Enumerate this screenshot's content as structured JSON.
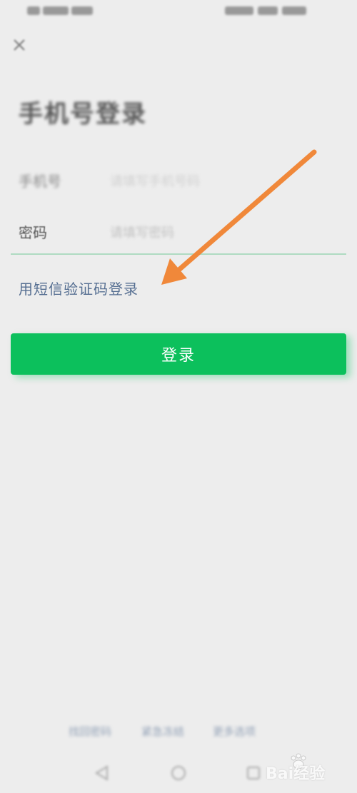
{
  "status_bar": {
    "left_text": "",
    "right_text": ""
  },
  "header": {
    "title": "手机号登录"
  },
  "form": {
    "phone": {
      "label": "手机号",
      "placeholder": "请填写手机号码"
    },
    "password": {
      "label": "密码",
      "placeholder": "请填写密码"
    }
  },
  "actions": {
    "sms_login_link": "用短信验证码登录",
    "login_button": "登录"
  },
  "footer": {
    "links": [
      "找回密码",
      "紧急冻结",
      "更多选项"
    ]
  },
  "watermark": {
    "text": "Bai经验"
  },
  "colors": {
    "primary_green": "#0cc05c",
    "link_blue": "#566f92",
    "background": "#ededed",
    "arrow_orange": "#f0883a"
  },
  "icons": {
    "close": "close-icon",
    "back": "back-triangle-icon",
    "home": "home-circle-icon",
    "recents": "recents-square-icon",
    "watermark_logo": "baidu-paw-icon"
  }
}
